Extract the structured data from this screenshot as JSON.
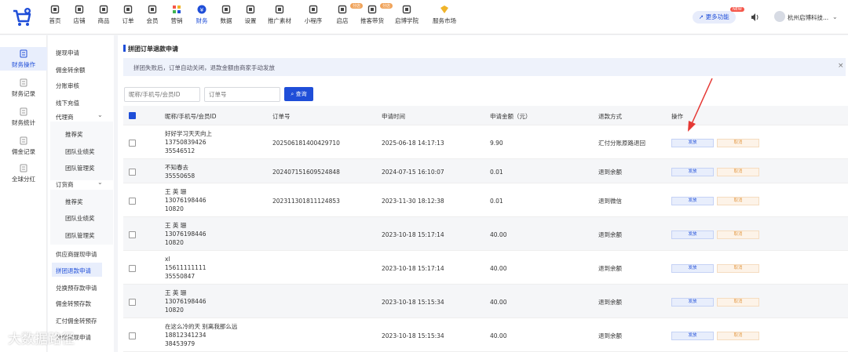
{
  "nav": {
    "items": [
      {
        "label": "首页",
        "icon": "home-icon"
      },
      {
        "label": "店铺",
        "icon": "store-icon"
      },
      {
        "label": "商品",
        "icon": "goods-icon"
      },
      {
        "label": "订单",
        "icon": "order-icon"
      },
      {
        "label": "会员",
        "icon": "member-icon"
      },
      {
        "label": "营销",
        "icon": "marketing-icon"
      },
      {
        "label": "财务",
        "icon": "finance-icon",
        "active": true
      },
      {
        "label": "数据",
        "icon": "chart-icon"
      },
      {
        "label": "设置",
        "icon": "gear-icon"
      },
      {
        "label": "推广素材",
        "icon": "share-icon"
      },
      {
        "label": "小程序",
        "icon": "miniapp-icon"
      },
      {
        "label": "启店",
        "icon": "shop-icon",
        "badge": "分店"
      },
      {
        "label": "推客带货",
        "icon": "live-icon",
        "badge": "分店"
      },
      {
        "label": "启博学院",
        "icon": "academy-icon"
      },
      {
        "label": "服务市场",
        "icon": "market-icon"
      }
    ],
    "more_label": "更多功能",
    "new_badge": "NEW",
    "shop_name": "杭州启博科技..."
  },
  "side1": [
    {
      "label": "财务操作",
      "active": true
    },
    {
      "label": "财务记录"
    },
    {
      "label": "财务统计"
    },
    {
      "label": "佣金记录"
    },
    {
      "label": "全球分红"
    }
  ],
  "side2": {
    "items": [
      "提现申请",
      "佣金转余额",
      "分账审核",
      "线下充值"
    ],
    "group1": "代理商",
    "group1_sub": [
      "推荐奖",
      "团队业绩奖",
      "团队管理奖"
    ],
    "group2": "订货商",
    "group2_sub": [
      "推荐奖",
      "团队业绩奖",
      "团队管理奖"
    ],
    "items2": [
      "供应商提现申请",
      "拼团退款申请",
      "兑换预存款申请",
      "佣金转预存款",
      "汇付佣金转预存",
      "分账提现申请"
    ]
  },
  "page": {
    "title": "拼团订单退款申请",
    "notice": "拼团失败后，订单自动关闭，退款金额由商家手动发放",
    "search_placeholder_1": "昵称/手机号/会员ID",
    "search_placeholder_2": "订单号",
    "search_button": "查询"
  },
  "table": {
    "headers": [
      "昵称/手机号/会员ID",
      "订单号",
      "申请时间",
      "申请金额（元）",
      "退款方式",
      "操作"
    ],
    "grant_label": "发放",
    "cancel_label": "取消",
    "rows": [
      {
        "nick": "好好学习天天向上",
        "phone": "13750839426",
        "id": "35546512",
        "order": "202506181400429710",
        "time": "2025-06-18 14:17:13",
        "amount": "9.90",
        "method": "汇付分账原路退回"
      },
      {
        "nick": "不知春去",
        "phone": "",
        "id": "35550658",
        "order": "202407151609524848",
        "time": "2024-07-15 16:10:07",
        "amount": "0.01",
        "method": "退到余额"
      },
      {
        "nick": "王 英 珊",
        "phone": "13076198446",
        "id": "10820",
        "order": "202311301811124853",
        "time": "2023-11-30 18:12:38",
        "amount": "0.01",
        "method": "退到微信"
      },
      {
        "nick": "王 英 珊",
        "phone": "13076198446",
        "id": "10820",
        "order": "",
        "time": "2023-10-18 15:17:14",
        "amount": "40.00",
        "method": "退到余额"
      },
      {
        "nick": "xl",
        "phone": "15611111111",
        "id": "35550847",
        "order": "",
        "time": "2023-10-18 15:17:14",
        "amount": "40.00",
        "method": "退到余额"
      },
      {
        "nick": "王 英 珊",
        "phone": "13076198446",
        "id": "10820",
        "order": "",
        "time": "2023-10-18 15:15:34",
        "amount": "40.00",
        "method": "退到余额"
      },
      {
        "nick": "在这么冷的天 别离我那么远",
        "phone": "18812341234",
        "id": "38453979",
        "order": "",
        "time": "2023-10-18 15:15:34",
        "amount": "40.00",
        "method": "退到余额"
      }
    ]
  },
  "watermark": "大数据路径",
  "colors": {
    "accent": "#1f4ed8",
    "cancel": "#e39b48",
    "arrow": "#e53935"
  }
}
